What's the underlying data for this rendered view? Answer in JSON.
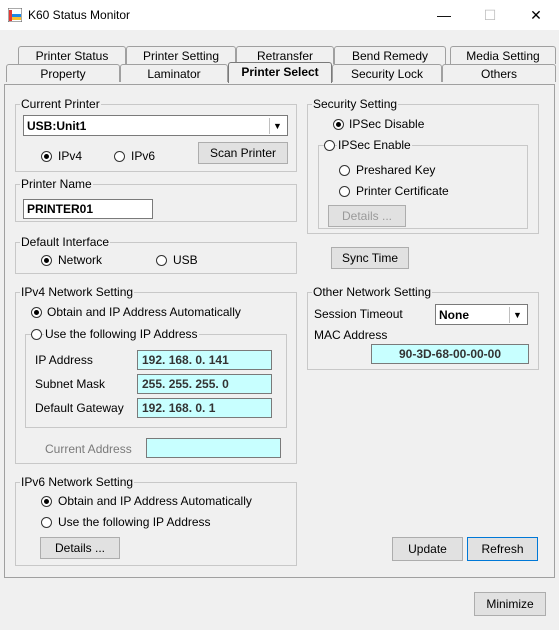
{
  "window": {
    "title": "K60 Status Monitor",
    "minimize_glyph": "—",
    "maximize_glyph": "☐",
    "close_glyph": "✕"
  },
  "tabs_row1": [
    "Printer Status",
    "Printer Setting",
    "Retransfer",
    "Bend Remedy",
    "Media Setting"
  ],
  "tabs_row2": [
    "Property",
    "Laminator",
    "Printer Select",
    "Security Lock",
    "Others"
  ],
  "active_tab": "Printer Select",
  "current_printer": {
    "legend": "Current Printer",
    "selected": "USB:Unit1",
    "ipv4_label": "IPv4",
    "ipv6_label": "IPv6",
    "ip_version": "IPv4",
    "scan_label": "Scan Printer"
  },
  "printer_name": {
    "legend": "Printer Name",
    "value": "PRINTER01"
  },
  "default_interface": {
    "legend": "Default Interface",
    "network_label": "Network",
    "usb_label": "USB",
    "selected": "Network"
  },
  "ipv4": {
    "legend": "IPv4 Network Setting",
    "auto_label": "Obtain and IP Address Automatically",
    "manual_label": "Use the following IP Address",
    "mode": "auto",
    "ip_label": "IP Address",
    "ip_value": "192. 168. 0. 141",
    "mask_label": "Subnet Mask",
    "mask_value": "255. 255. 255. 0",
    "gateway_label": "Default Gateway",
    "gateway_value": "192. 168. 0. 1",
    "current_label": "Current Address",
    "current_value": ""
  },
  "ipv6": {
    "legend": "IPv6 Network Setting",
    "auto_label": "Obtain and IP Address Automatically",
    "manual_label": "Use the following IP Address",
    "mode": "auto",
    "details_label": "Details ..."
  },
  "security": {
    "legend": "Security Setting",
    "disable_label": "IPSec Disable",
    "enable_label": "IPSec Enable",
    "mode": "disable",
    "preshared_label": "Preshared Key",
    "certificate_label": "Printer Certificate",
    "details_label": "Details ..."
  },
  "sync_time_label": "Sync Time",
  "other_network": {
    "legend": "Other Network Setting",
    "timeout_label": "Session Timeout",
    "timeout_value": "None",
    "mac_label": "MAC Address",
    "mac_value": "90-3D-68-00-00-00"
  },
  "update_label": "Update",
  "refresh_label": "Refresh",
  "minimize_label": "Minimize",
  "colors": {
    "field_highlight": "#c8ffff",
    "background": "#f0f0f0"
  }
}
